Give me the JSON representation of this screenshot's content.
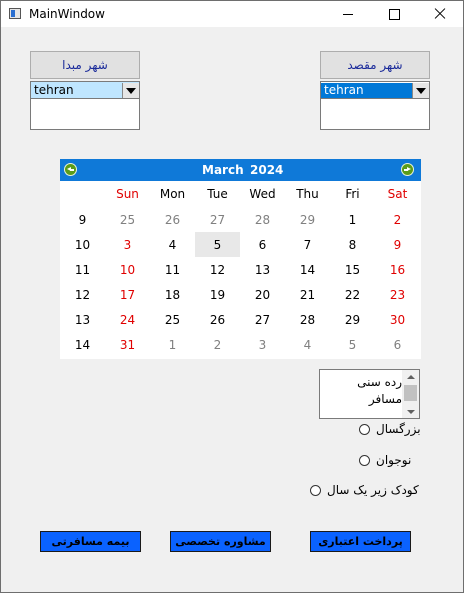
{
  "window": {
    "title": "MainWindow"
  },
  "origin": {
    "label": "شهر مبدا",
    "selected": "tehran"
  },
  "destination": {
    "label": "شهر مقصد",
    "selected": "tehran"
  },
  "calendar": {
    "month": "March",
    "year": "2024",
    "day_names": [
      "Sun",
      "Mon",
      "Tue",
      "Wed",
      "Thu",
      "Fri",
      "Sat"
    ],
    "today": "5",
    "weeks": [
      {
        "num": "9",
        "days": [
          "25",
          "26",
          "27",
          "28",
          "29",
          "1",
          "2"
        ]
      },
      {
        "num": "10",
        "days": [
          "3",
          "4",
          "5",
          "6",
          "7",
          "8",
          "9"
        ]
      },
      {
        "num": "11",
        "days": [
          "10",
          "11",
          "12",
          "13",
          "14",
          "15",
          "16"
        ]
      },
      {
        "num": "12",
        "days": [
          "17",
          "18",
          "19",
          "20",
          "21",
          "22",
          "23"
        ]
      },
      {
        "num": "13",
        "days": [
          "24",
          "25",
          "26",
          "27",
          "28",
          "29",
          "30"
        ]
      },
      {
        "num": "14",
        "days": [
          "31",
          "1",
          "2",
          "3",
          "4",
          "5",
          "6"
        ]
      }
    ]
  },
  "age_group": {
    "list_text": "رده سنی مسافر",
    "options": [
      "بزرگسال",
      "نوجوان",
      "کودک زیر یک سال"
    ]
  },
  "buttons": {
    "insurance": "بیمه مسافرتی",
    "consultation": "مشاوره تخصصی",
    "credit_payment": "پرداخت اعتباری"
  },
  "colors": {
    "calendar_header": "#0f79d8",
    "weekend": "#e00000",
    "button": "#0a62ff",
    "combo_selected_origin": "#bfe6ff",
    "combo_selected_destination": "#0078d7"
  }
}
